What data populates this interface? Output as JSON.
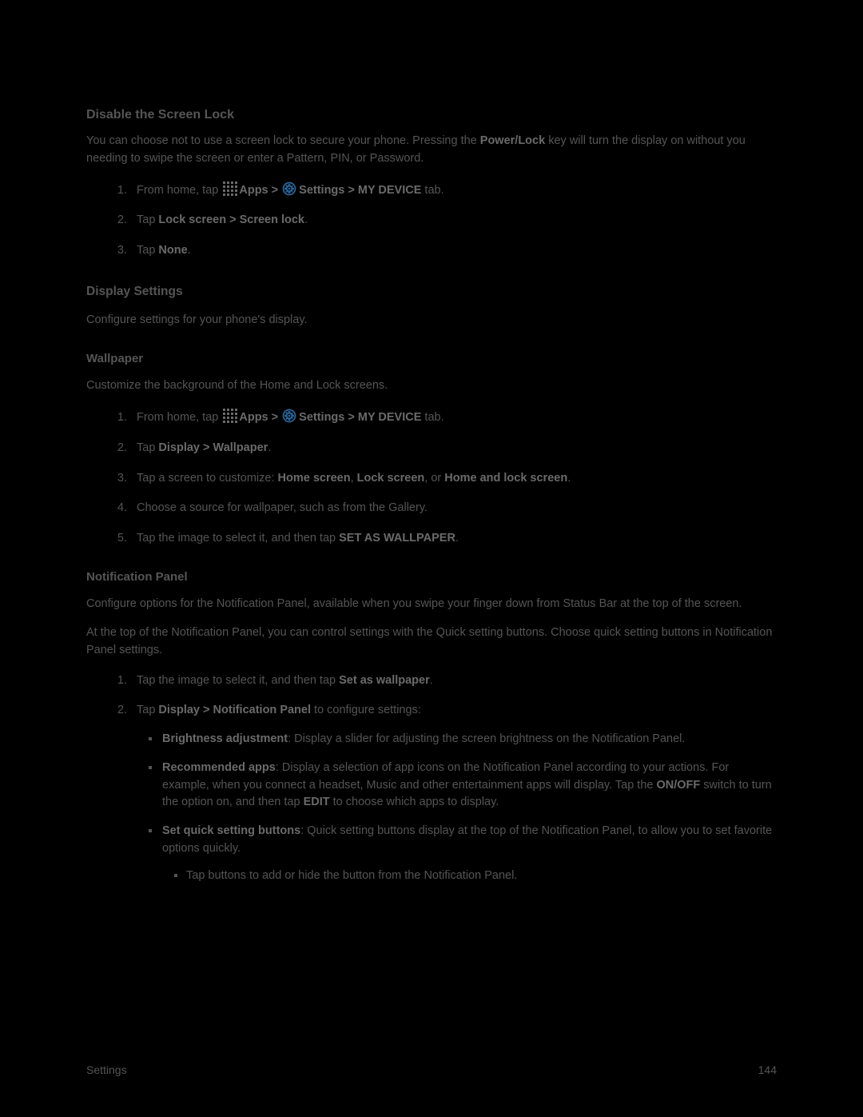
{
  "disable": {
    "heading": "Disable the Screen Lock",
    "p1_a": "You can choose not to use a screen lock to secure your phone. Pressing the ",
    "powerlock": "Power/Lock",
    "p1_b": " key will turn the display on without you needing to swipe the screen or enter a Pattern, PIN, or Password.",
    "steps": {
      "s1_a": "From home, tap ",
      "s1_apps": "Apps",
      "s1_gt1": " > ",
      "s1_settings": "Settings",
      "s1_gt2": " > ",
      "s1_mydev": "MY DEVICE",
      "s1_b": " tab.",
      "s2_a": "Tap ",
      "s2_b": "Lock screen",
      "s2_c": " > ",
      "s2_d": "Screen lock",
      "s2_e": ".",
      "s3_a": "Tap ",
      "s3_b": "None",
      "s3_c": "."
    }
  },
  "display": {
    "heading": "Display Settings",
    "intro": "Configure settings for your phone's display."
  },
  "wallpaper": {
    "heading": "Wallpaper",
    "intro": "Customize the background of the Home and Lock screens.",
    "steps": {
      "s1_a": "From home, tap ",
      "s1_apps": "Apps",
      "s1_gt1": " > ",
      "s1_settings": "Settings",
      "s1_gt2": " > ",
      "s1_mydev": "MY DEVICE",
      "s1_b": " tab.",
      "s2_a": "Tap ",
      "s2_b": "Display",
      "s2_c": " > ",
      "s2_d": "Wallpaper",
      "s2_e": ".",
      "s3_a": "Tap a screen to customize: ",
      "s3_h": "Home screen",
      "s3_c1": ", ",
      "s3_l": "Lock screen",
      "s3_c2": ", or ",
      "s3_hl": "Home and lock screen",
      "s3_e": ".",
      "s4": "Choose a source for wallpaper, such as from the Gallery.",
      "s5_a": "Tap the image to select it, and then tap ",
      "s5_b": "SET AS WALLPAPER",
      "s5_c": "."
    }
  },
  "notif": {
    "heading": "Notification Panel",
    "p1": "Configure options for the Notification Panel, available when you swipe your finger down from Status Bar at the top of the screen.",
    "p2": "At the top of the Notification Panel, you can control settings with the Quick setting buttons. Choose quick setting buttons in Notification Panel settings.",
    "steps": {
      "s1_a": "Tap the image to select it, and then tap ",
      "s1_b": "Set as wallpaper",
      "s1_c": ".",
      "s2_a": "Tap ",
      "s2_b": "Display",
      "s2_c": " > ",
      "s2_d": "Notification Panel",
      "s2_e": " to configure settings:"
    },
    "bullets": {
      "b1_t": "Brightness adjustment",
      "b1_r": ": Display a slider for adjusting the screen brightness on the Notification Panel.",
      "b2_t": "Recommended apps",
      "b2_r1": ": Display a selection of app icons on the Notification Panel according to your actions. For example, when you connect a headset, Music and other entertainment apps will display. Tap the ",
      "b2_onoff": "ON/OFF",
      "b2_r2": " switch to turn the option on, and then tap ",
      "b2_edit": "EDIT",
      "b2_r3": " to choose which apps to display.",
      "b3_t": "Set quick setting buttons",
      "b3_r": ": Quick setting buttons display at the top of the Notification Panel, to allow you to set favorite options quickly.",
      "b3_sub1": "Tap buttons to add or hide the button from the Notification Panel."
    }
  },
  "footer": {
    "section": "Settings",
    "page": "144"
  }
}
